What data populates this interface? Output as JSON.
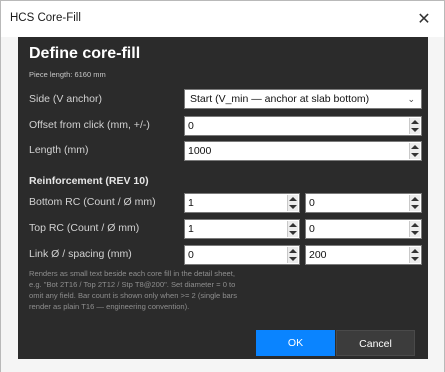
{
  "window": {
    "title": "HCS Core-Fill",
    "close_glyph": "✕"
  },
  "dialog": {
    "heading": "Define core-fill",
    "piece_length": "Piece length: 6160 mm",
    "side": {
      "label": "Side (V anchor)",
      "selected": "Start (V_min — anchor at slab bottom)"
    },
    "offset": {
      "label": "Offset from click (mm, +/-)",
      "value": "0"
    },
    "length": {
      "label": "Length (mm)",
      "value": "1000"
    },
    "reinforcement": {
      "title": "Reinforcement (REV 10)",
      "bottom": {
        "label": "Bottom RC (Count / Ø mm)",
        "count": "1",
        "diameter": "0"
      },
      "top": {
        "label": "Top RC (Count / Ø mm)",
        "count": "1",
        "diameter": "0"
      },
      "link": {
        "label": "Link Ø / spacing (mm)",
        "diameter": "0",
        "spacing": "200"
      }
    },
    "help_lines": [
      "Renders as small text beside each core fill in the detail sheet,",
      "e.g. \"Bot 2T16 / Top 2T12 / Stp T8@200\". Set diameter = 0 to",
      "omit any field. Bar count is shown only when >= 2 (single bars",
      "render as plain T16 — engineering convention)."
    ],
    "ok_label": "OK",
    "cancel_label": "Cancel"
  },
  "colors": {
    "dialog_bg": "#2b2b2b",
    "accent": "#0a84ff"
  }
}
